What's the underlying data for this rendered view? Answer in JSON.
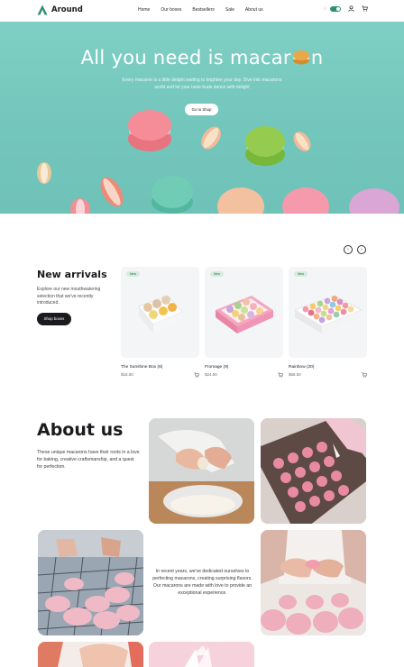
{
  "header": {
    "brand": "Around",
    "nav": [
      "Home",
      "Our boxes",
      "Bestsellers",
      "Sale",
      "About us"
    ],
    "theme_toggle_label": "☾",
    "colors": {
      "brand": "#2f8f75"
    }
  },
  "hero": {
    "title_before_icon": "All you need is macar",
    "title_after_icon": "n",
    "subtitle": "Every macaron is a little delight waiting to brighten your day. Dive into macarons world and let your taste buds dance with delight",
    "cta": "Go to Shop",
    "background_color": "#75c8be"
  },
  "arrivals": {
    "title": "New arrivals",
    "description": "Explore our new mouthwatering selection that we've recently introduced.",
    "cta": "Shop boxes",
    "prev_label": "‹",
    "next_label": "›",
    "products": [
      {
        "badge": "New",
        "name": "The Sunshine Box (6)",
        "price": "$18.00",
        "icon": "cart-icon"
      },
      {
        "badge": "New",
        "name": "Fromage (9)",
        "price": "$24.00",
        "icon": "cart-icon"
      },
      {
        "badge": "New",
        "name": "Rainbow (20)",
        "price": "$58.00",
        "icon": "cart-icon"
      }
    ]
  },
  "about": {
    "title": "About us",
    "paragraph1": "These unique macarons have their roots in a love for baking, creative craftsmanship, and a quest for perfection.",
    "paragraph2": "In recent years, we've dedicated ourselves to perfecting macarons, creating surprising flavors. Our macarons are made with love to provide an exceptional experience."
  }
}
